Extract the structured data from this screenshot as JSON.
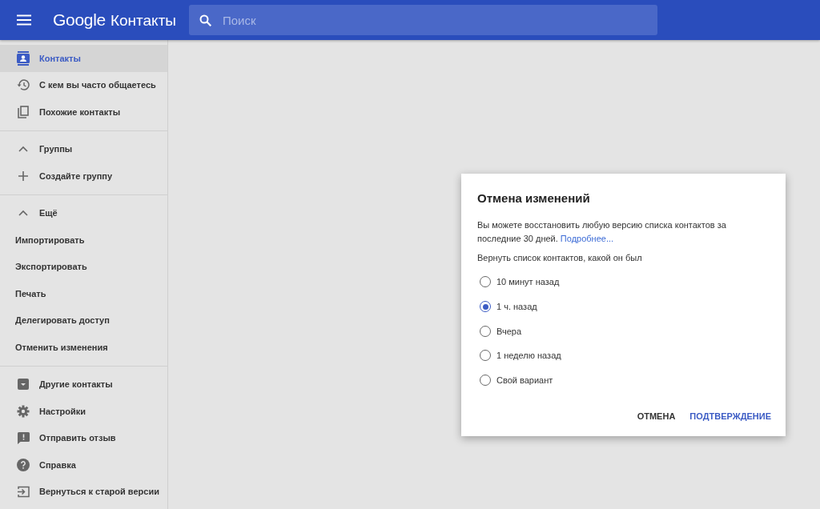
{
  "header": {
    "logo_brand": "Google",
    "logo_product": "Контакты",
    "search": {
      "placeholder": "Поиск"
    }
  },
  "sidebar": {
    "sections": [
      {
        "items": [
          {
            "kind": "contacts",
            "label": "Контакты",
            "selected": true
          },
          {
            "kind": "history",
            "label": "С кем вы часто общаетесь",
            "selected": false
          },
          {
            "kind": "copy",
            "label": "Похожие контакты",
            "selected": false
          }
        ]
      },
      {
        "items": [
          {
            "kind": "caret",
            "label": "Группы",
            "selected": false
          },
          {
            "kind": "plus",
            "label": "Создайте группу",
            "selected": false
          }
        ]
      },
      {
        "items": [
          {
            "kind": "caret",
            "label": "Ещё",
            "selected": false
          },
          {
            "kind": "plain",
            "label": "Импортировать",
            "selected": false
          },
          {
            "kind": "plain",
            "label": "Экспортировать",
            "selected": false
          },
          {
            "kind": "plain",
            "label": "Печать",
            "selected": false
          },
          {
            "kind": "plain",
            "label": "Делегировать доступ",
            "selected": false
          },
          {
            "kind": "plain",
            "label": "Отменить изменения",
            "selected": false
          }
        ]
      },
      {
        "items": [
          {
            "kind": "archive",
            "label": "Другие контакты",
            "selected": false
          },
          {
            "kind": "gear",
            "label": "Настройки",
            "selected": false
          },
          {
            "kind": "feedback",
            "label": "Отправить отзыв",
            "selected": false
          },
          {
            "kind": "help",
            "label": "Справка",
            "selected": false
          },
          {
            "kind": "exit",
            "label": "Вернуться к старой версии",
            "selected": false
          }
        ]
      }
    ]
  },
  "dialog": {
    "title": "Отмена изменений",
    "description": "Вы можете восстановить любую версию списка контактов за последние 30 дней.",
    "link": "Подробнее...",
    "prompt": "Вернуть список контактов, какой он был",
    "options": [
      {
        "label": "10 минут назад",
        "selected": false
      },
      {
        "label": "1 ч. назад",
        "selected": true
      },
      {
        "label": "Вчера",
        "selected": false
      },
      {
        "label": "1 неделю назад",
        "selected": false
      },
      {
        "label": "Свой вариант",
        "selected": false
      }
    ],
    "buttons": [
      {
        "label": "ОТМЕНА",
        "kind": "secondary"
      },
      {
        "label": "ПОДТВЕРЖДЕНИЕ",
        "kind": "primary"
      }
    ]
  }
}
